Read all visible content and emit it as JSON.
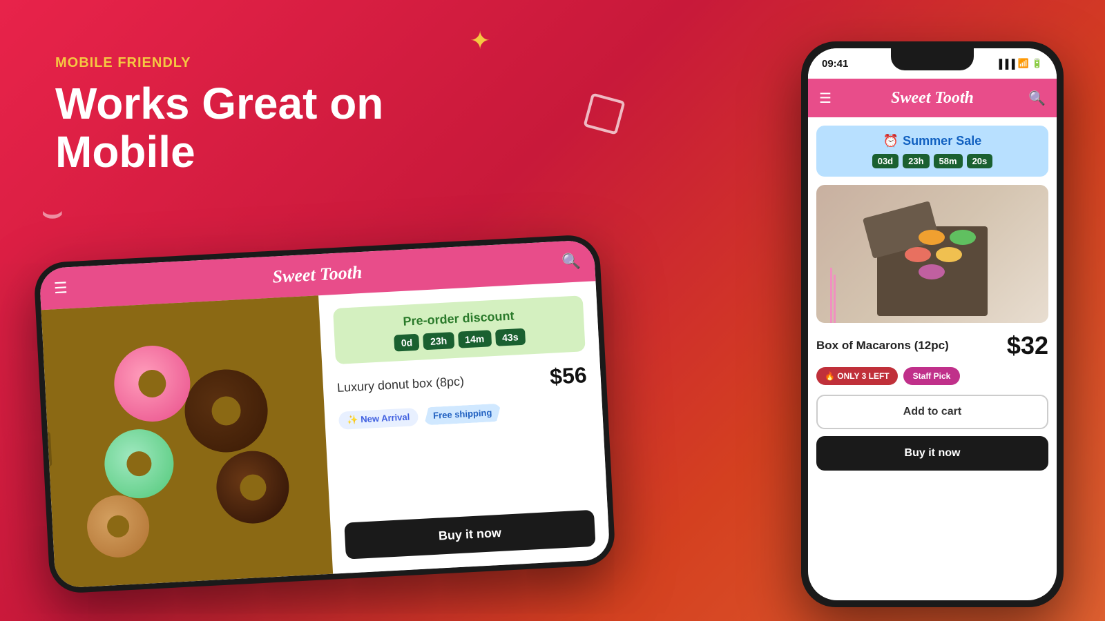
{
  "background": {
    "gradient": "linear-gradient(135deg, #e8234a 0%, #c8193a 40%, #d44020 70%, #e06030 100%)"
  },
  "label": {
    "mobile_friendly": "MOBILE FRIENDLY",
    "heading": "Works Great on Mobile"
  },
  "phone_landscape": {
    "app_name": "Sweet Tooth",
    "preorder": {
      "label": "Pre-order discount",
      "countdown": [
        "0d",
        "23h",
        "14m",
        "43s"
      ]
    },
    "product": {
      "name": "Luxury donut box (8pc)",
      "price": "$56"
    },
    "tags": {
      "new_arrival": "✨ New Arrival",
      "shipping": "Free shipping"
    },
    "buy_button": "Buy it now"
  },
  "phone_portrait": {
    "status_time": "09:41",
    "app_name": "Sweet Tooth",
    "sale": {
      "icon": "⏰",
      "label": "Summer Sale",
      "countdown": [
        "03d",
        "23h",
        "58m",
        "20s"
      ]
    },
    "product": {
      "name": "Box of Macarons (12pc)",
      "price": "$32"
    },
    "tags": {
      "fire": "🔥 ONLY 3 LEFT",
      "staff": "Staff Pick"
    },
    "add_cart": "Add to cart",
    "buy_button": "Buy it now"
  }
}
